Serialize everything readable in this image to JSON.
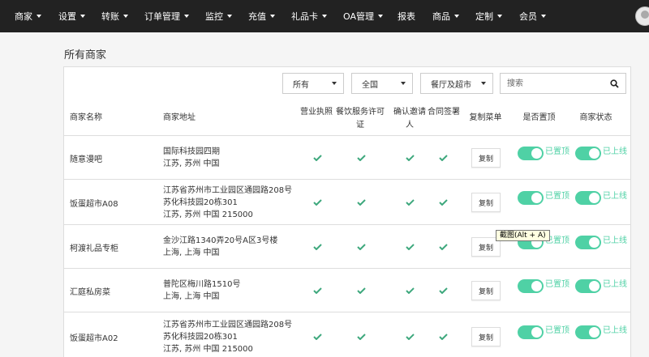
{
  "nav": {
    "items": [
      {
        "label": "商家",
        "dropdown": true
      },
      {
        "label": "设置",
        "dropdown": true
      },
      {
        "label": "转账",
        "dropdown": true
      },
      {
        "label": "订单管理",
        "dropdown": true
      },
      {
        "label": "监控",
        "dropdown": true
      },
      {
        "label": "充值",
        "dropdown": true
      },
      {
        "label": "礼品卡",
        "dropdown": true
      },
      {
        "label": "OA管理",
        "dropdown": true
      },
      {
        "label": "报表",
        "dropdown": false
      },
      {
        "label": "商品",
        "dropdown": true
      },
      {
        "label": "定制",
        "dropdown": true
      },
      {
        "label": "会员",
        "dropdown": true
      }
    ]
  },
  "page": {
    "title": "所有商家"
  },
  "filters": {
    "status_select": "所有",
    "region_select": "全国",
    "type_select": "餐厅及超市",
    "search_placeholder": "搜索"
  },
  "table": {
    "headers": {
      "name": "商家名称",
      "address": "商家地址",
      "license": "营业执照",
      "food_permit": "餐饮服务许可证",
      "invite": "确认邀请人",
      "contract": "合同签署",
      "copy_menu": "复制菜单",
      "pinned": "是否置顶",
      "status": "商家状态"
    },
    "copy_label": "复制",
    "pinned_label": "已置顶",
    "status_label": "已上线",
    "rows": [
      {
        "name": "随意漫吧",
        "address": [
          "国际科技园四期",
          "江苏, 苏州 中国"
        ]
      },
      {
        "name": "饭蛋超市A08",
        "address": [
          "江苏省苏州市工业园区通园路208号",
          "苏化科技园20栋301",
          "江苏, 苏州 中国 215000"
        ]
      },
      {
        "name": "柯渡礼品专柜",
        "address": [
          "金沙江路1340弄20号A区3号楼",
          "上海, 上海 中国"
        ]
      },
      {
        "name": "汇庭私房菜",
        "address": [
          "普陀区梅川路1510号",
          "上海, 上海 中国"
        ]
      },
      {
        "name": "饭蛋超市A02",
        "address": [
          "江苏省苏州市工业园区通园路208号",
          "苏化科技园20栋301",
          "江苏, 苏州 中国 215000"
        ]
      }
    ]
  },
  "tooltip": {
    "text": "截图(Alt + A)"
  },
  "colors": {
    "navbar": "#222222",
    "accent": "#4fd1a5",
    "check": "#3ea87d"
  }
}
